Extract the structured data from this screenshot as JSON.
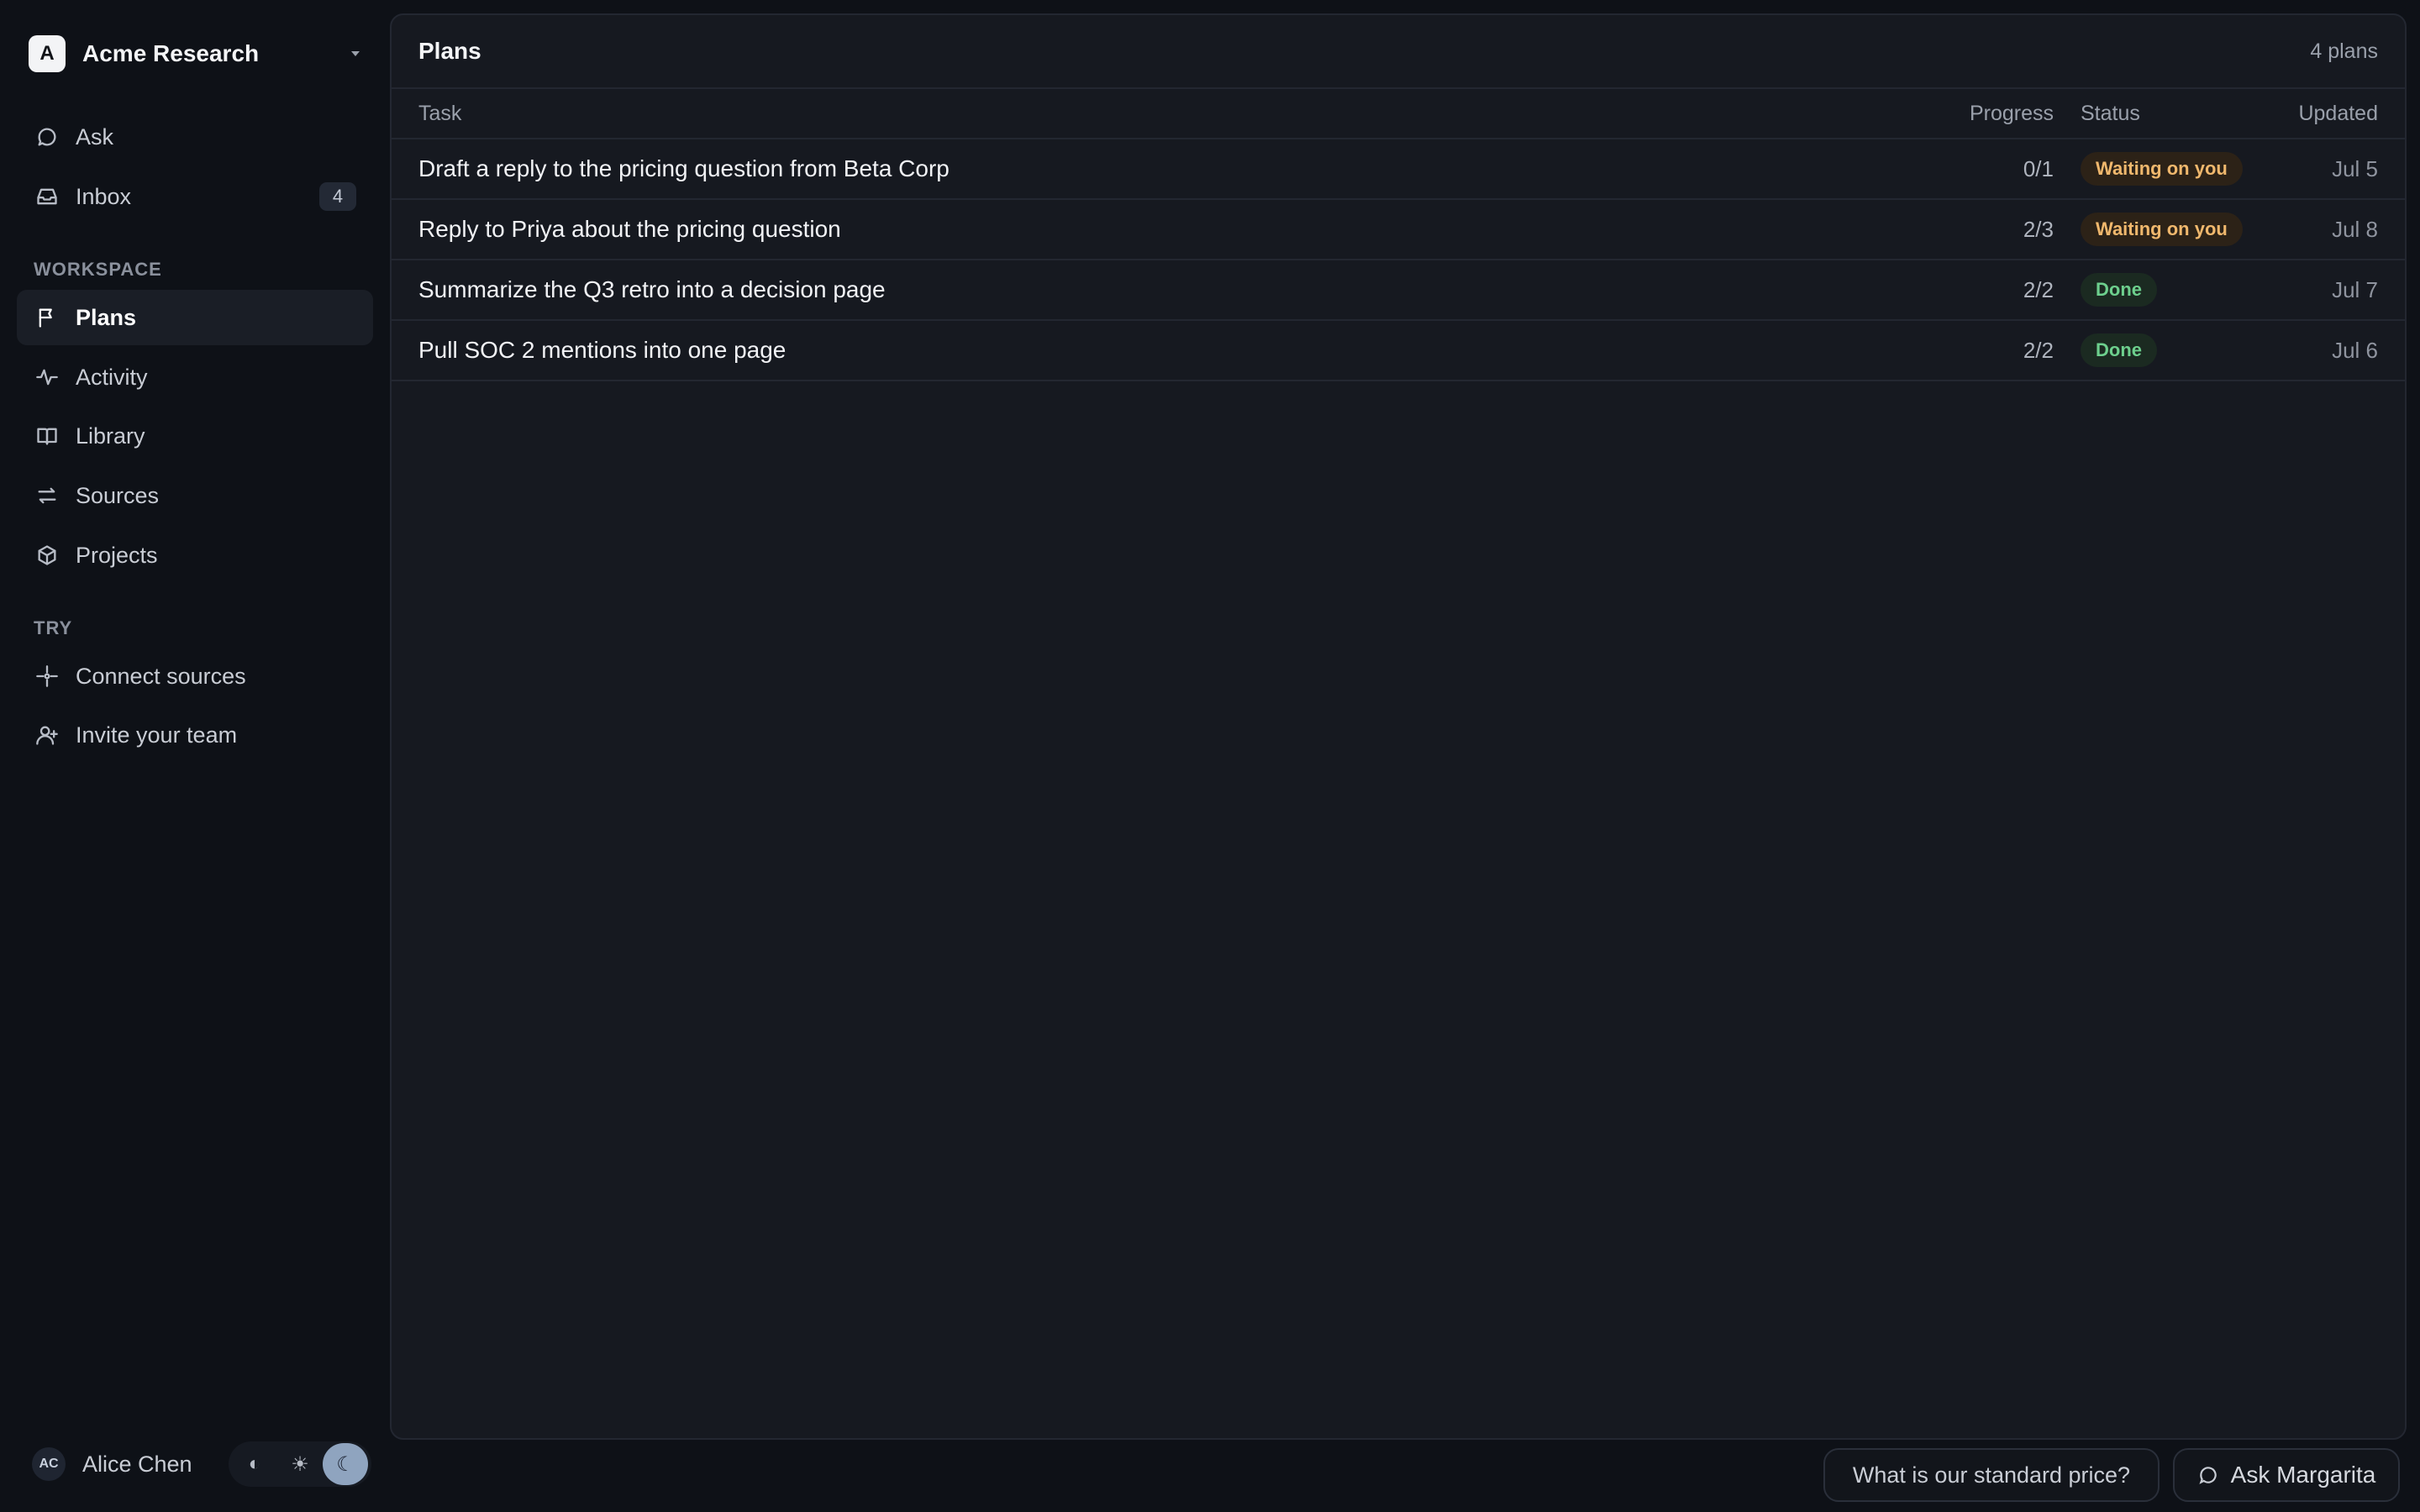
{
  "workspace": {
    "logo_letter": "A",
    "name": "Acme Research"
  },
  "nav": {
    "ask": "Ask",
    "inbox": "Inbox",
    "inbox_badge": "4",
    "workspace_label": "WORKSPACE",
    "plans": "Plans",
    "activity": "Activity",
    "library": "Library",
    "sources": "Sources",
    "projects": "Projects",
    "try_label": "TRY",
    "connect_sources": "Connect sources",
    "invite_team": "Invite your team"
  },
  "user": {
    "initials": "AC",
    "name": "Alice Chen"
  },
  "theme": {
    "auto_icon": "◐",
    "light_icon": "☀",
    "dark_icon": "☾",
    "selected": "dark"
  },
  "panel": {
    "title": "Plans",
    "count": "4 plans"
  },
  "table": {
    "headers": {
      "task": "Task",
      "progress": "Progress",
      "status": "Status",
      "updated": "Updated"
    },
    "rows": [
      {
        "task": "Draft a reply to the pricing question from Beta Corp",
        "progress": "0/1",
        "status": "Waiting on you",
        "updated": "Jul 5"
      },
      {
        "task": "Reply to Priya about the pricing question",
        "progress": "2/3",
        "status": "Waiting on you",
        "updated": "Jul 8"
      },
      {
        "task": "Summarize the Q3 retro into a decision page",
        "progress": "2/2",
        "status": "Done",
        "updated": "Jul 7"
      },
      {
        "task": "Pull SOC 2 mentions into one page",
        "progress": "2/2",
        "status": "Done",
        "updated": "Jul 6"
      }
    ]
  },
  "footer": {
    "suggestion": "What is our standard price?",
    "ask_button": "Ask Margarita"
  },
  "colors": {
    "waiting": "#f0b86d",
    "done": "#6dcf8d",
    "background": "#0e1117",
    "panel": "#161920"
  }
}
